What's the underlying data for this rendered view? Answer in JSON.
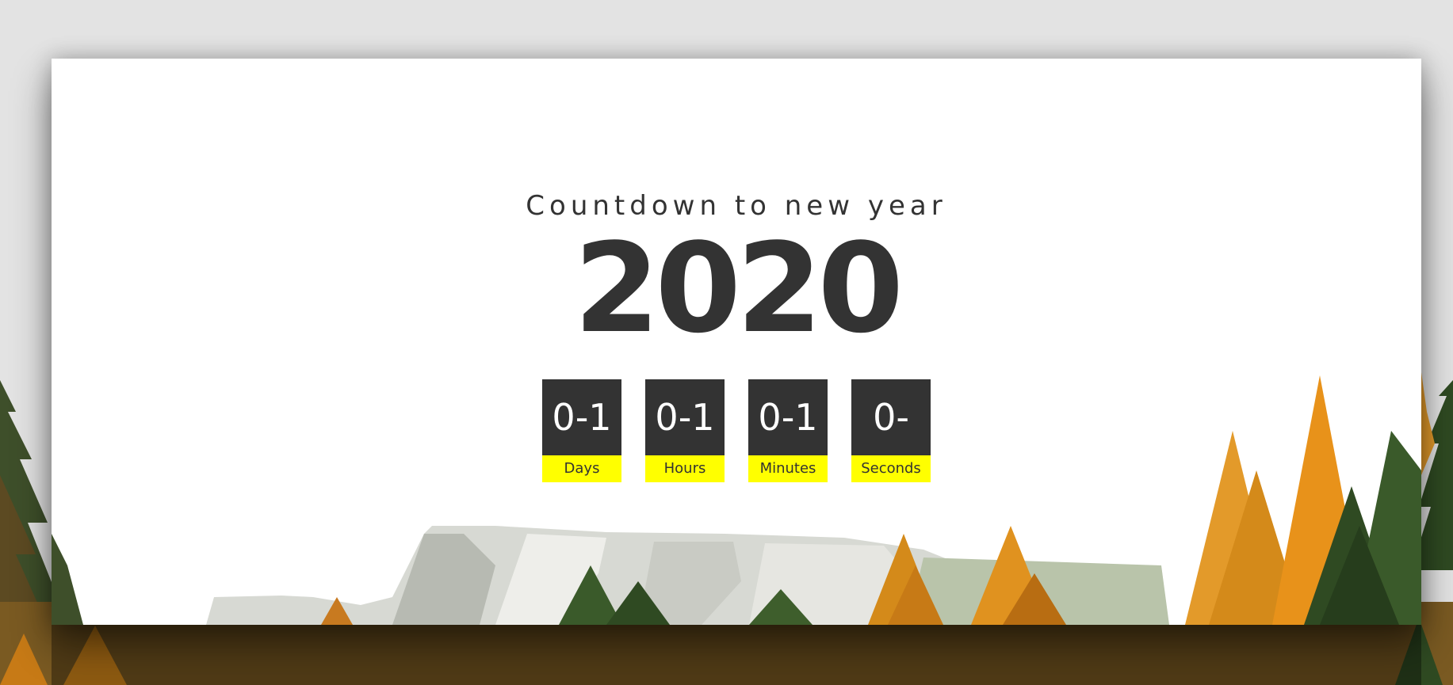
{
  "page": {
    "subtitle": "Countdown to new year",
    "year": "2020"
  },
  "countdown": [
    {
      "value": "0-1",
      "label": "Days"
    },
    {
      "value": "0-1",
      "label": "Hours"
    },
    {
      "value": "0-1",
      "label": "Minutes"
    },
    {
      "value": "0-",
      "label": "Seconds"
    }
  ],
  "colors": {
    "page_background": "#e3e3e3",
    "card_background": "#ffffff",
    "text": "#333333",
    "box_background": "#333333",
    "label_background": "#ffff00",
    "autumn_orange": "#e8921a",
    "pine_green": "#2f4a22"
  }
}
